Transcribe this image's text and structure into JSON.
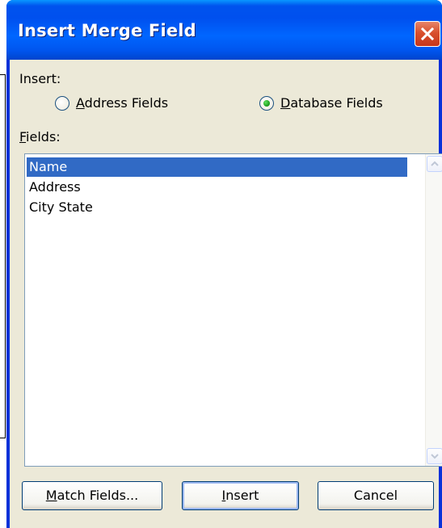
{
  "window": {
    "title": "Insert Merge Field"
  },
  "insert_group": {
    "label": "Insert:",
    "options": [
      {
        "label": "Address Fields",
        "mnemonic": "A",
        "selected": false
      },
      {
        "label": "Database Fields",
        "mnemonic": "D",
        "selected": true
      }
    ]
  },
  "fields": {
    "label": "Fields:",
    "items": [
      "Name",
      "Address",
      "City State"
    ],
    "selected": "Name"
  },
  "buttons": {
    "match_fields": "Match Fields...",
    "insert": "Insert",
    "cancel": "Cancel"
  },
  "colors": {
    "titlebar": "#0058ee",
    "selection": "#316ac5",
    "dialog_bg": "#ece9d8",
    "close_button": "#d9502d"
  }
}
